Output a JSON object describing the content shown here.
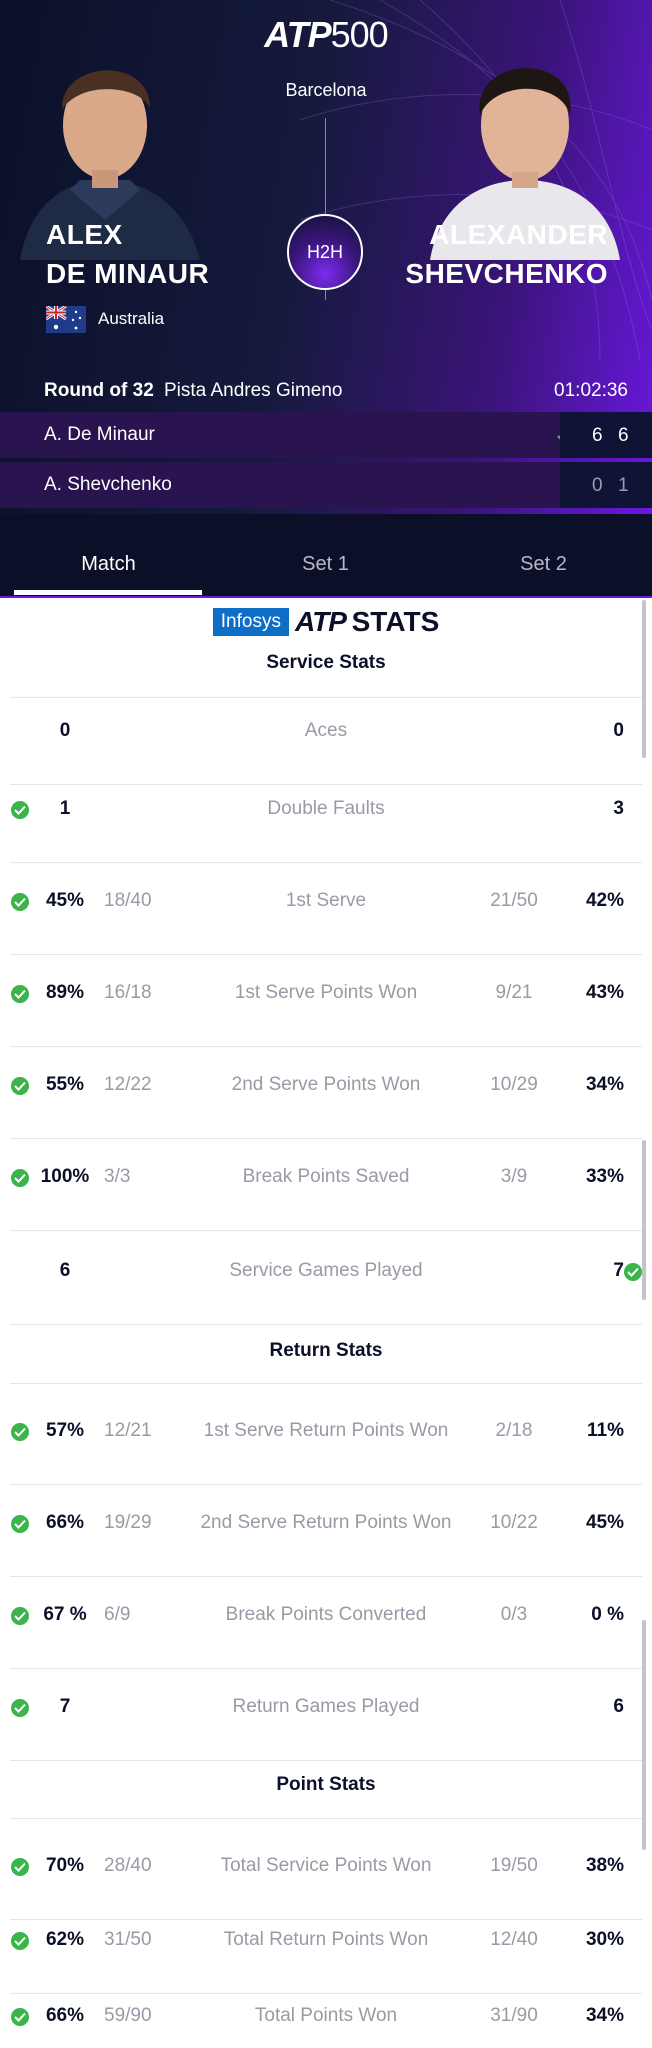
{
  "header": {
    "logo_brand": "ATP",
    "logo_num": "500",
    "location": "Barcelona",
    "h2h_label": "H2H",
    "player1": {
      "first": "ALEX",
      "last": "DE MINAUR",
      "country": "Australia"
    },
    "player2": {
      "first": "ALEXANDER",
      "last": "SHEVCHENKO"
    }
  },
  "match": {
    "round": "Round of 32",
    "court": "Pista Andres Gimeno",
    "duration": "01:02:36",
    "rows": [
      {
        "name": "A. De Minaur",
        "set1": "6",
        "set2": "6",
        "winner": true
      },
      {
        "name": "A. Shevchenko",
        "set1": "0",
        "set2": "1",
        "winner": false
      }
    ]
  },
  "tabs": [
    "Match",
    "Set 1",
    "Set 2"
  ],
  "stats_logo": {
    "infosys": "Infosys",
    "atp": "ATP",
    "stats": "STATS"
  },
  "sections": {
    "service": "Service Stats",
    "return": "Return Stats",
    "points": "Point Stats"
  },
  "service_stats": [
    {
      "label": "Aces",
      "left": "0",
      "left_frac": "",
      "right_frac": "",
      "right": "0",
      "winner": "none"
    },
    {
      "label": "Double Faults",
      "left": "1",
      "left_frac": "",
      "right_frac": "",
      "right": "3",
      "winner": "left"
    },
    {
      "label": "1st Serve",
      "left": "45%",
      "left_frac": "18/40",
      "right_frac": "21/50",
      "right": "42%",
      "winner": "left"
    },
    {
      "label": "1st Serve Points Won",
      "left": "89%",
      "left_frac": "16/18",
      "right_frac": "9/21",
      "right": "43%",
      "winner": "left"
    },
    {
      "label": "2nd Serve Points Won",
      "left": "55%",
      "left_frac": "12/22",
      "right_frac": "10/29",
      "right": "34%",
      "winner": "left"
    },
    {
      "label": "Break Points Saved",
      "left": "100%",
      "left_frac": "3/3",
      "right_frac": "3/9",
      "right": "33%",
      "winner": "left"
    },
    {
      "label": "Service Games Played",
      "left": "6",
      "left_frac": "",
      "right_frac": "",
      "right": "7",
      "winner": "right"
    }
  ],
  "return_stats": [
    {
      "label": "1st Serve Return Points Won",
      "left": "57%",
      "left_frac": "12/21",
      "right_frac": "2/18",
      "right": "11%",
      "winner": "left"
    },
    {
      "label": "2nd Serve Return Points Won",
      "left": "66%",
      "left_frac": "19/29",
      "right_frac": "10/22",
      "right": "45%",
      "winner": "left"
    },
    {
      "label": "Break Points Converted",
      "left": "67 %",
      "left_frac": "6/9",
      "right_frac": "0/3",
      "right": "0 %",
      "winner": "left"
    },
    {
      "label": "Return Games Played",
      "left": "7",
      "left_frac": "",
      "right_frac": "",
      "right": "6",
      "winner": "left"
    }
  ],
  "point_stats": [
    {
      "label": "Total Service Points Won",
      "left": "70%",
      "left_frac": "28/40",
      "right_frac": "19/50",
      "right": "38%",
      "winner": "left"
    },
    {
      "label": "Total Return Points Won",
      "left": "62%",
      "left_frac": "31/50",
      "right_frac": "12/40",
      "right": "30%",
      "winner": "left"
    },
    {
      "label": "Total Points Won",
      "left": "66%",
      "left_frac": "59/90",
      "right_frac": "31/90",
      "right": "34%",
      "winner": "left"
    }
  ],
  "colors": {
    "accent": "#6a18e0",
    "win": "#3bb54a",
    "dark": "#0b1028",
    "muted": "#9a9aa6"
  }
}
